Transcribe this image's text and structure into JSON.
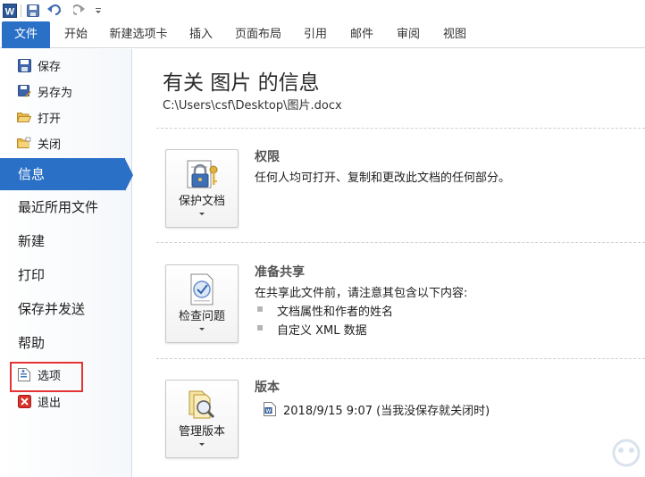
{
  "qat": {
    "icons": [
      "word-app-icon",
      "save-icon",
      "undo-icon",
      "redo-icon",
      "customize-qat-icon"
    ]
  },
  "ribbon": {
    "tabs": [
      {
        "label": "文件",
        "active": true
      },
      {
        "label": "开始"
      },
      {
        "label": "新建选项卡"
      },
      {
        "label": "插入"
      },
      {
        "label": "页面布局"
      },
      {
        "label": "引用"
      },
      {
        "label": "邮件"
      },
      {
        "label": "审阅"
      },
      {
        "label": "视图"
      }
    ]
  },
  "backstage": {
    "commands": [
      {
        "label": "保存",
        "icon": "save-icon"
      },
      {
        "label": "另存为",
        "icon": "save-as-icon"
      },
      {
        "label": "打开",
        "icon": "open-folder-icon"
      },
      {
        "label": "关闭",
        "icon": "close-folder-icon"
      }
    ],
    "tabs": [
      {
        "label": "信息",
        "active": true
      },
      {
        "label": "最近所用文件"
      },
      {
        "label": "新建"
      },
      {
        "label": "打印"
      },
      {
        "label": "保存并发送"
      },
      {
        "label": "帮助"
      }
    ],
    "footer": [
      {
        "label": "选项",
        "icon": "options-icon",
        "highlighted": true
      },
      {
        "label": "退出",
        "icon": "exit-icon"
      }
    ]
  },
  "info": {
    "title": "有关 图片 的信息",
    "path": "C:\\Users\\csf\\Desktop\\图片.docx",
    "sections": [
      {
        "button": "保护文档",
        "button_icon": "lock-key-icon",
        "heading": "权限",
        "text": "任何人均可打开、复制和更改此文档的任何部分。"
      },
      {
        "button": "检查问题",
        "button_icon": "check-document-icon",
        "heading": "准备共享",
        "text": "在共享此文件前，请注意其包含以下内容:",
        "bullets": [
          "文档属性和作者的姓名",
          "自定义 XML 数据"
        ]
      },
      {
        "button": "管理版本",
        "button_icon": "manage-versions-icon",
        "heading": "版本",
        "version": "2018/9/15 9:07 (当我没保存就关闭时)"
      }
    ]
  },
  "colors": {
    "accent": "#2a70c6",
    "highlight": "#e53333"
  }
}
